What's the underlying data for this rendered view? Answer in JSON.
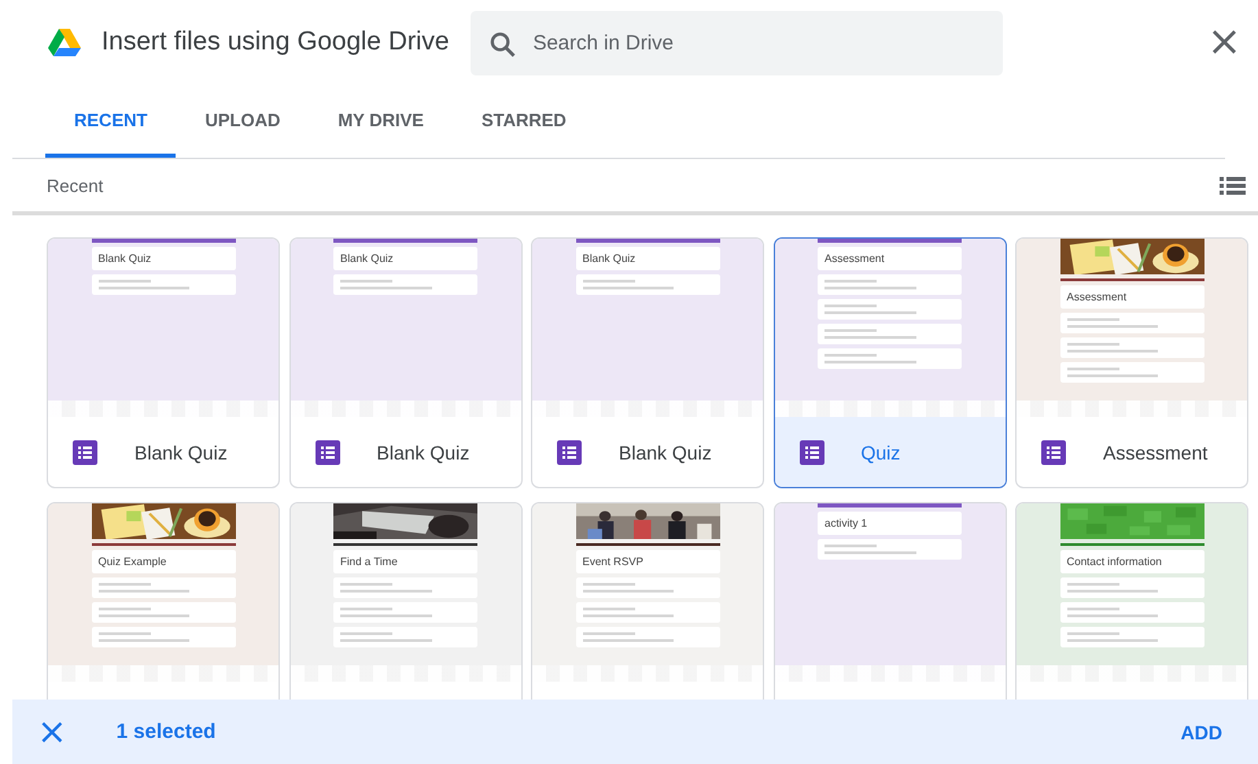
{
  "dialog": {
    "title": "Insert files using Google Drive",
    "close_label": "×"
  },
  "search": {
    "placeholder": "Search in Drive"
  },
  "tabs": [
    {
      "label": "RECENT",
      "selected": true
    },
    {
      "label": "UPLOAD",
      "selected": false
    },
    {
      "label": "MY DRIVE",
      "selected": false
    },
    {
      "label": "STARRED",
      "selected": false
    }
  ],
  "section_label": "Recent",
  "files": [
    {
      "name": "Blank Quiz",
      "selected": false,
      "thumbnail": {
        "title": "Blank Quiz",
        "kind": "plain",
        "color": "#ede7f6"
      }
    },
    {
      "name": "Blank Quiz",
      "selected": false,
      "thumbnail": {
        "title": "Blank Quiz",
        "kind": "plain",
        "color": "#ede7f6"
      }
    },
    {
      "name": "Blank Quiz",
      "selected": false,
      "thumbnail": {
        "title": "Blank Quiz",
        "kind": "plain",
        "color": "#ede7f6"
      }
    },
    {
      "name": "Quiz",
      "selected": true,
      "thumbnail": {
        "title": "Assessment",
        "kind": "long",
        "color": "#ede7f6"
      }
    },
    {
      "name": "Assessment",
      "selected": false,
      "thumbnail": {
        "title": "Assessment",
        "kind": "banner",
        "banner": {
          "kind": "desk"
        },
        "color": "#f3ece8"
      }
    },
    {
      "selected": false,
      "thumbnail": {
        "title": "Quiz Example",
        "kind": "banner",
        "banner": {
          "kind": "desk"
        },
        "color": "#f3ece8"
      }
    },
    {
      "selected": false,
      "thumbnail": {
        "title": "Find a Time",
        "kind": "banner",
        "banner": {
          "kind": "dark"
        },
        "color": "#f1f1f1"
      }
    },
    {
      "selected": false,
      "thumbnail": {
        "title": "Event RSVP",
        "kind": "banner",
        "banner": {
          "kind": "crowd"
        },
        "color": "#f3f2f0"
      }
    },
    {
      "selected": false,
      "thumbnail": {
        "title": "activity 1",
        "kind": "plain",
        "color": "#ede7f6"
      }
    },
    {
      "selected": false,
      "thumbnail": {
        "title": "Contact information",
        "kind": "banner",
        "banner": {
          "kind": "green"
        },
        "color": "#e3eee3"
      }
    }
  ],
  "selection_bar": {
    "clear_label": "×",
    "count": "1 selected",
    "action": "ADD"
  }
}
